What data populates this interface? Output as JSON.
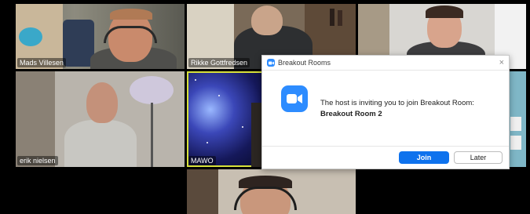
{
  "participants": [
    {
      "name": "Mads Villesen"
    },
    {
      "name": "Rikke Gottfredsen"
    },
    {
      "name": ""
    },
    {
      "name": "erik nielsen"
    },
    {
      "name": "MAWO"
    },
    {
      "name": ""
    },
    {
      "name": ""
    }
  ],
  "dialog": {
    "window_title": "Breakout Rooms",
    "message": "The host is inviting you to join Breakout Room:",
    "room_name": "Breakout Room 2",
    "join_label": "Join",
    "later_label": "Later",
    "close_glyph": "×",
    "icon": "zoom-camera-icon",
    "accent_color": "#2d8cff",
    "join_color": "#0e72ed"
  },
  "colors": {
    "active_speaker_border": "#d8e23a"
  }
}
